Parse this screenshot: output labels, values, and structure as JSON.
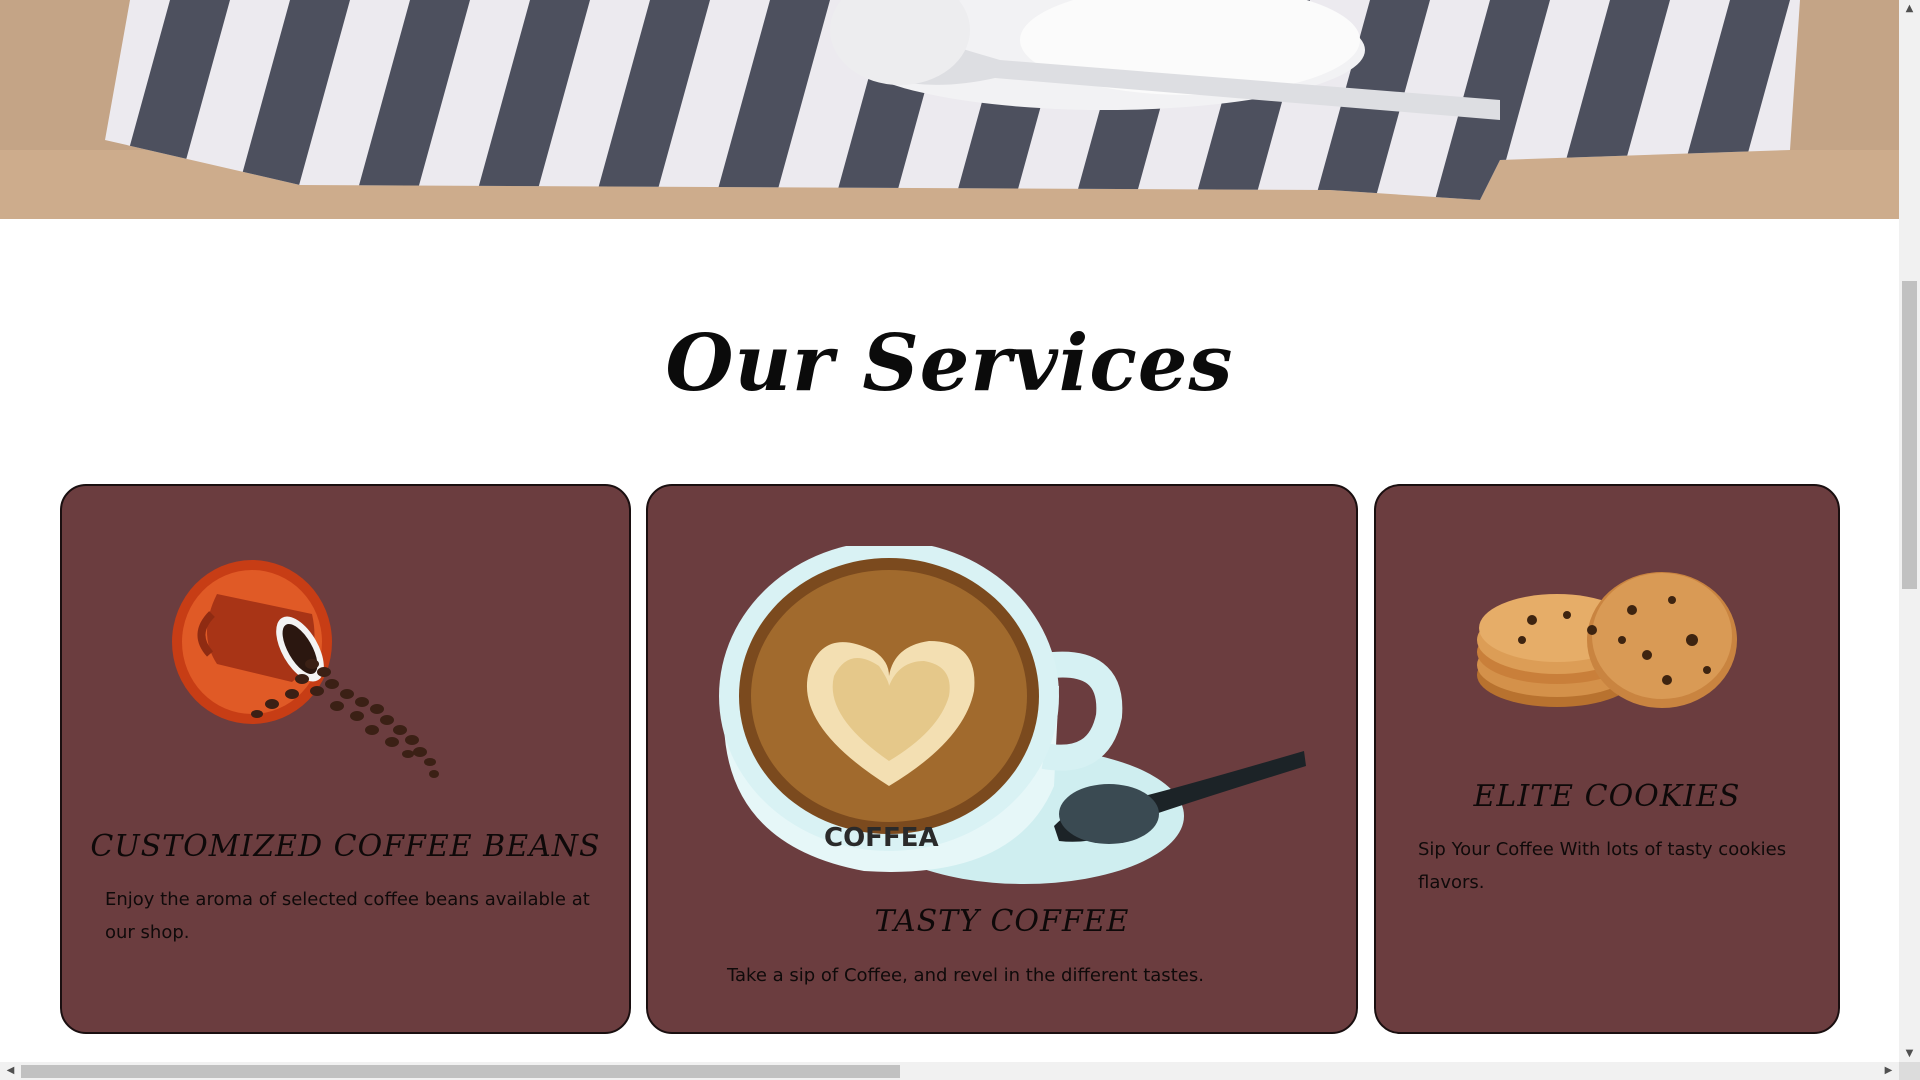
{
  "hero": {
    "image": "coffee-cup-on-striped-napkin"
  },
  "services": {
    "title": "Our Services",
    "cards": [
      {
        "image": "spilled-coffee-cup-beans",
        "title": "CUSTOMIZED COFFEE BEANS",
        "text": "Enjoy the aroma of selected coffee beans available at our shop."
      },
      {
        "image": "latte-art-cup",
        "cup_print": "COFFEA",
        "title": "TASTY COFFEE",
        "text": "Take a sip of Coffee, and revel in the different tastes."
      },
      {
        "image": "cookies-stack",
        "title": "ELITE COOKIES",
        "text": "Sip Your Coffee With lots of tasty cookies flavors."
      }
    ]
  },
  "colors": {
    "card_bg": "#6b3d3f",
    "card_border": "#1a0f10",
    "page_bg": "#ffffff"
  },
  "scrollbars": {
    "up": "▲",
    "down": "▼",
    "left": "◀",
    "right": "▶"
  }
}
